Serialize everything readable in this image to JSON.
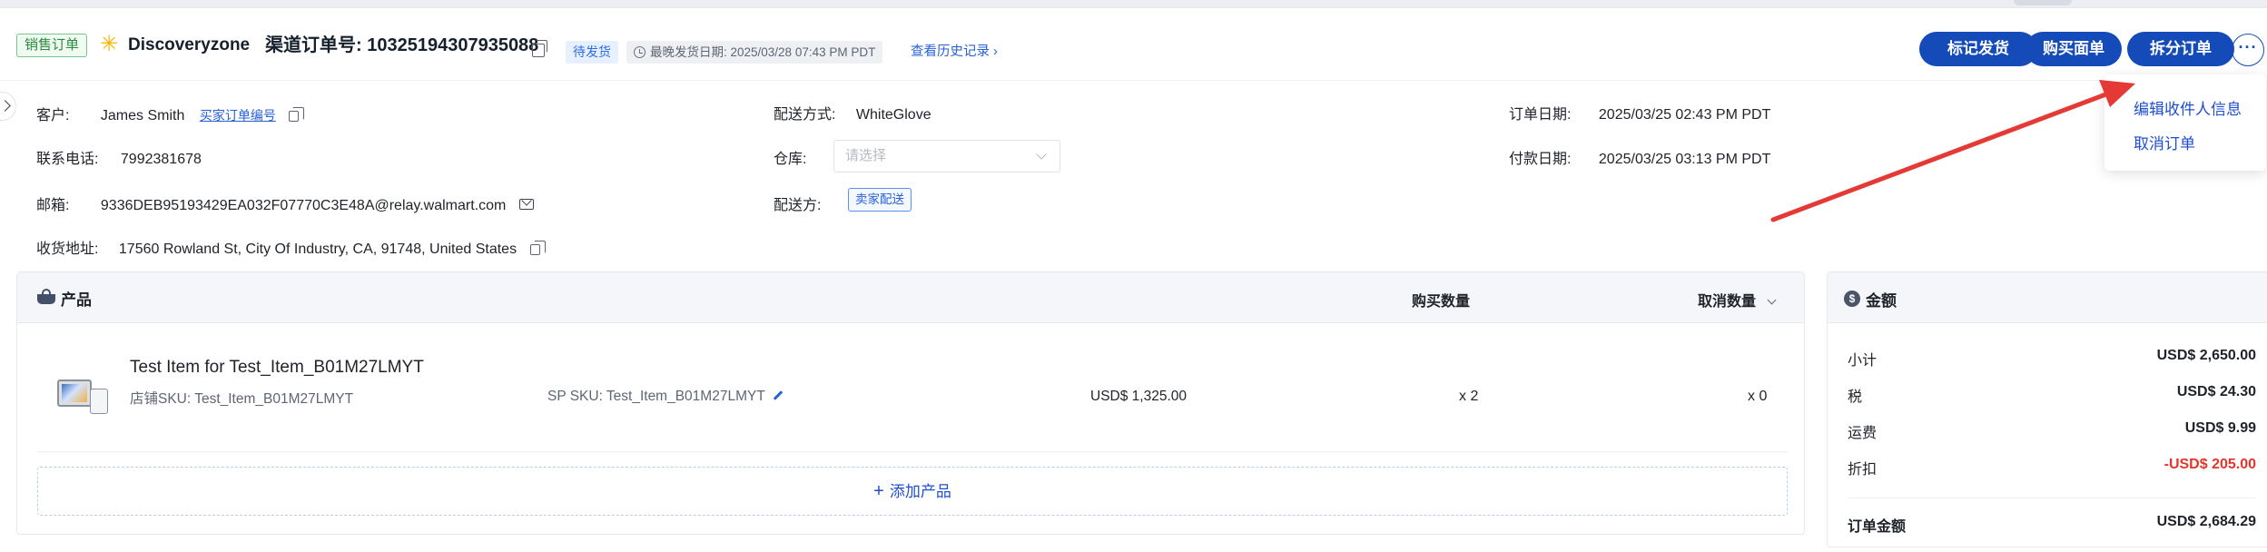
{
  "header": {
    "order_type_tag": "销售订单",
    "store_name": "Discoveryzone",
    "channel_order_label": "渠道订单号: 10325194307935088",
    "status_tag": "待发货",
    "latest_ship_date": "最晚发货日期:   2025/03/28 07:43 PM PDT",
    "history_link": "查看历史记录 ›",
    "buttons": {
      "mark_shipped": "标记发货",
      "buy_label": "购买面单",
      "split_order": "拆分订单",
      "more": "···"
    }
  },
  "dropdown": {
    "items": [
      "编辑收件人信息",
      "取消订单"
    ]
  },
  "info": {
    "customer_label": "客户:",
    "customer_value": "James Smith",
    "buyer_order_link": "买家订单编号",
    "phone_label": "联系电话:",
    "phone_value": "7992381678",
    "email_label": "邮箱:",
    "email_value": "9336DEB95193429EA032F07770C3E48A@relay.walmart.com",
    "address_label": "收货地址:",
    "address_value": "17560 Rowland St, City Of Industry, CA, 91748, United States",
    "delivery_method_label": "配送方式:",
    "delivery_method_value": "WhiteGlove",
    "warehouse_label": "仓库:",
    "warehouse_placeholder": "请选择",
    "shipper_label": "配送方:",
    "shipper_tag": "卖家配送",
    "order_date_label": "订单日期:",
    "order_date_value": "2025/03/25 02:43 PM PDT",
    "payment_date_label": "付款日期:",
    "payment_date_value": "2025/03/25 03:13 PM PDT"
  },
  "products": {
    "title": "产品",
    "col_buy_qty": "购买数量",
    "col_cancel_qty": "取消数量",
    "items": [
      {
        "name": "Test Item for Test_Item_B01M27LMYT",
        "store_sku": "店铺SKU: Test_Item_B01M27LMYT",
        "sp_sku": "SP SKU: Test_Item_B01M27LMYT",
        "price": "USD$ 1,325.00",
        "buy_qty": "x 2",
        "cancel_qty": "x 0"
      }
    ],
    "add_product": "添加产品"
  },
  "amount": {
    "title": "金额",
    "rows": [
      {
        "label": "小计",
        "value": "USD$ 2,650.00"
      },
      {
        "label": "税",
        "value": "USD$ 24.30"
      },
      {
        "label": "运费",
        "value": "USD$ 9.99"
      },
      {
        "label": "折扣",
        "value": "-USD$ 205.00"
      }
    ],
    "total_label": "订单金额",
    "total_value": "USD$ 2,684.29"
  },
  "colors": {
    "primary": "#154bb8",
    "link": "#2860d8",
    "discount_red": "#e5352b",
    "annotation_arrow": "#e53935"
  },
  "icons": [
    "walmart-spark-icon",
    "copy-icon",
    "clock-icon",
    "mail-icon",
    "basket-icon",
    "dollar-icon",
    "pencil-icon",
    "chevron-down-icon",
    "plus-icon"
  ]
}
